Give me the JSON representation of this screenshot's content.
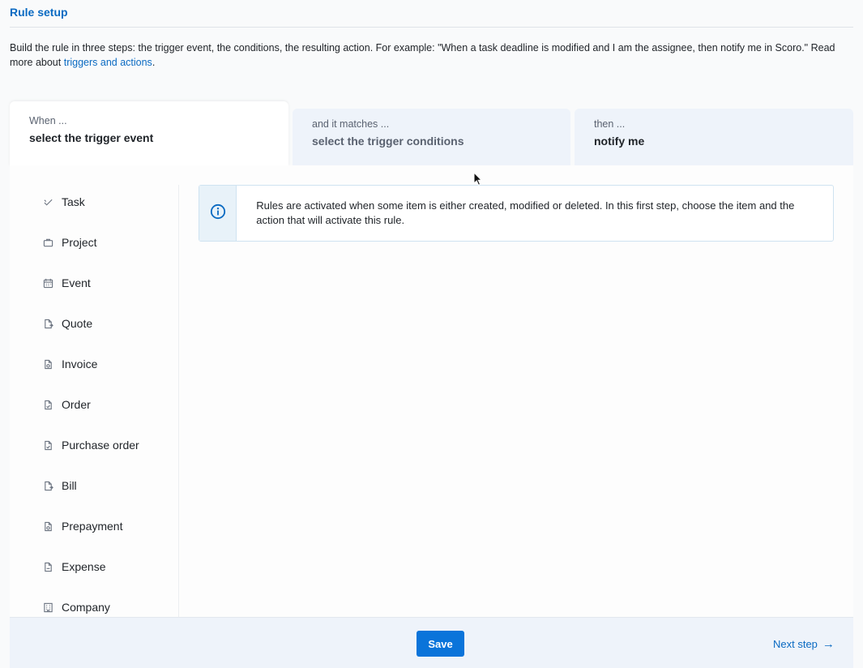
{
  "header": {
    "title": "Rule setup",
    "intro_text": "Build the rule in three steps: the trigger event, the conditions, the resulting action. For example: \"When a task deadline is modified and I am the assignee, then notify me in Scoro.\" Read more about ",
    "intro_link": "triggers and actions",
    "intro_end": "."
  },
  "tabs": [
    {
      "small": "When ...",
      "big": "select the trigger event",
      "active": true
    },
    {
      "small": "and it matches ...",
      "big": "select the trigger conditions",
      "active": false
    },
    {
      "small": "then ...",
      "big": "notify me",
      "active": false
    }
  ],
  "sidebar": {
    "items": [
      {
        "label": "Task",
        "icon": "task-icon"
      },
      {
        "label": "Project",
        "icon": "briefcase-icon"
      },
      {
        "label": "Event",
        "icon": "calendar-icon"
      },
      {
        "label": "Quote",
        "icon": "quote-doc-icon"
      },
      {
        "label": "Invoice",
        "icon": "invoice-doc-icon"
      },
      {
        "label": "Order",
        "icon": "order-doc-icon"
      },
      {
        "label": "Purchase order",
        "icon": "purchase-order-doc-icon"
      },
      {
        "label": "Bill",
        "icon": "bill-doc-icon"
      },
      {
        "label": "Prepayment",
        "icon": "prepayment-doc-icon"
      },
      {
        "label": "Expense",
        "icon": "expense-doc-icon"
      },
      {
        "label": "Company",
        "icon": "building-icon"
      }
    ]
  },
  "notice": {
    "icon": "info-icon",
    "text": "Rules are activated when some item is either created, modified or deleted. In this first step, choose the item and the action that will activate this rule."
  },
  "footer": {
    "save_label": "Save",
    "next_label": "Next step",
    "next_icon": "arrow-right-icon"
  },
  "colors": {
    "accent": "#0a74da",
    "link": "#0a6ac2"
  }
}
